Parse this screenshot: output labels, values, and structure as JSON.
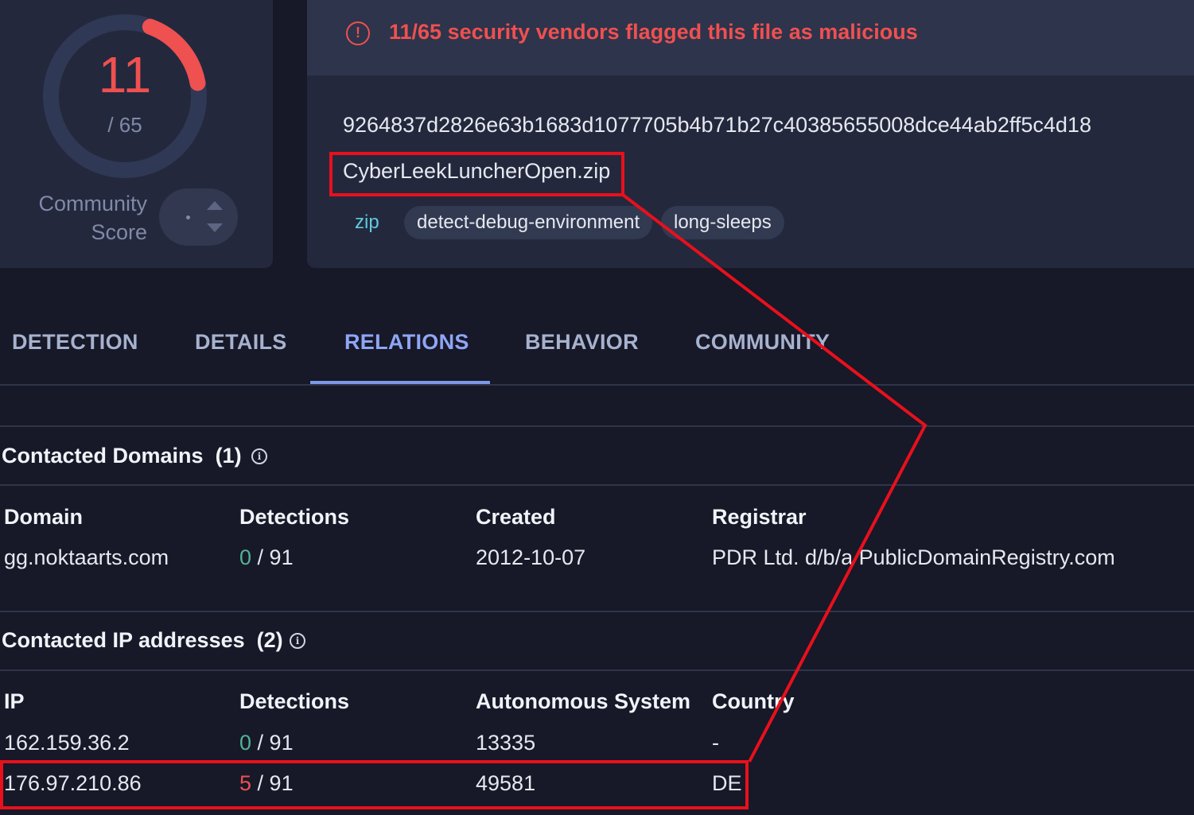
{
  "score": {
    "detected": "11",
    "total": "/ 65",
    "community_label": "Community Score",
    "score_fraction": 0.169,
    "ring_color": "#ef5050"
  },
  "alert": {
    "icon": "exclamation-circle-icon",
    "text": "11/65 security vendors flagged this file as malicious"
  },
  "file": {
    "hash": "9264837d2826e63b1683d1077705b4b71b27c40385655008dce44ab2ff5c4d18",
    "name": "CyberLeekLuncherOpen.zip",
    "tags": [
      "zip",
      "detect-debug-environment",
      "long-sleeps"
    ]
  },
  "tabs": [
    "DETECTION",
    "DETAILS",
    "RELATIONS",
    "BEHAVIOR",
    "COMMUNITY"
  ],
  "active_tab": "RELATIONS",
  "domains": {
    "title": "Contacted Domains",
    "count": "(1)",
    "headers": [
      "Domain",
      "Detections",
      "Created",
      "Registrar"
    ],
    "rows": [
      {
        "domain": "gg.noktaarts.com",
        "det": "0",
        "det_total": "/ 91",
        "created": "2012-10-07",
        "registrar": "PDR Ltd. d/b/a PublicDomainRegistry.com"
      }
    ]
  },
  "ips": {
    "title": "Contacted IP addresses",
    "count": "(2)",
    "headers": [
      "IP",
      "Detections",
      "Autonomous System",
      "Country"
    ],
    "rows": [
      {
        "ip": "162.159.36.2",
        "det": "0",
        "det_total": "/ 91",
        "as": "13335",
        "country": "-"
      },
      {
        "ip": "176.97.210.86",
        "det": "5",
        "det_total": "/ 91",
        "as": "49581",
        "country": "DE"
      }
    ]
  },
  "annotation_color": "#e8101c"
}
